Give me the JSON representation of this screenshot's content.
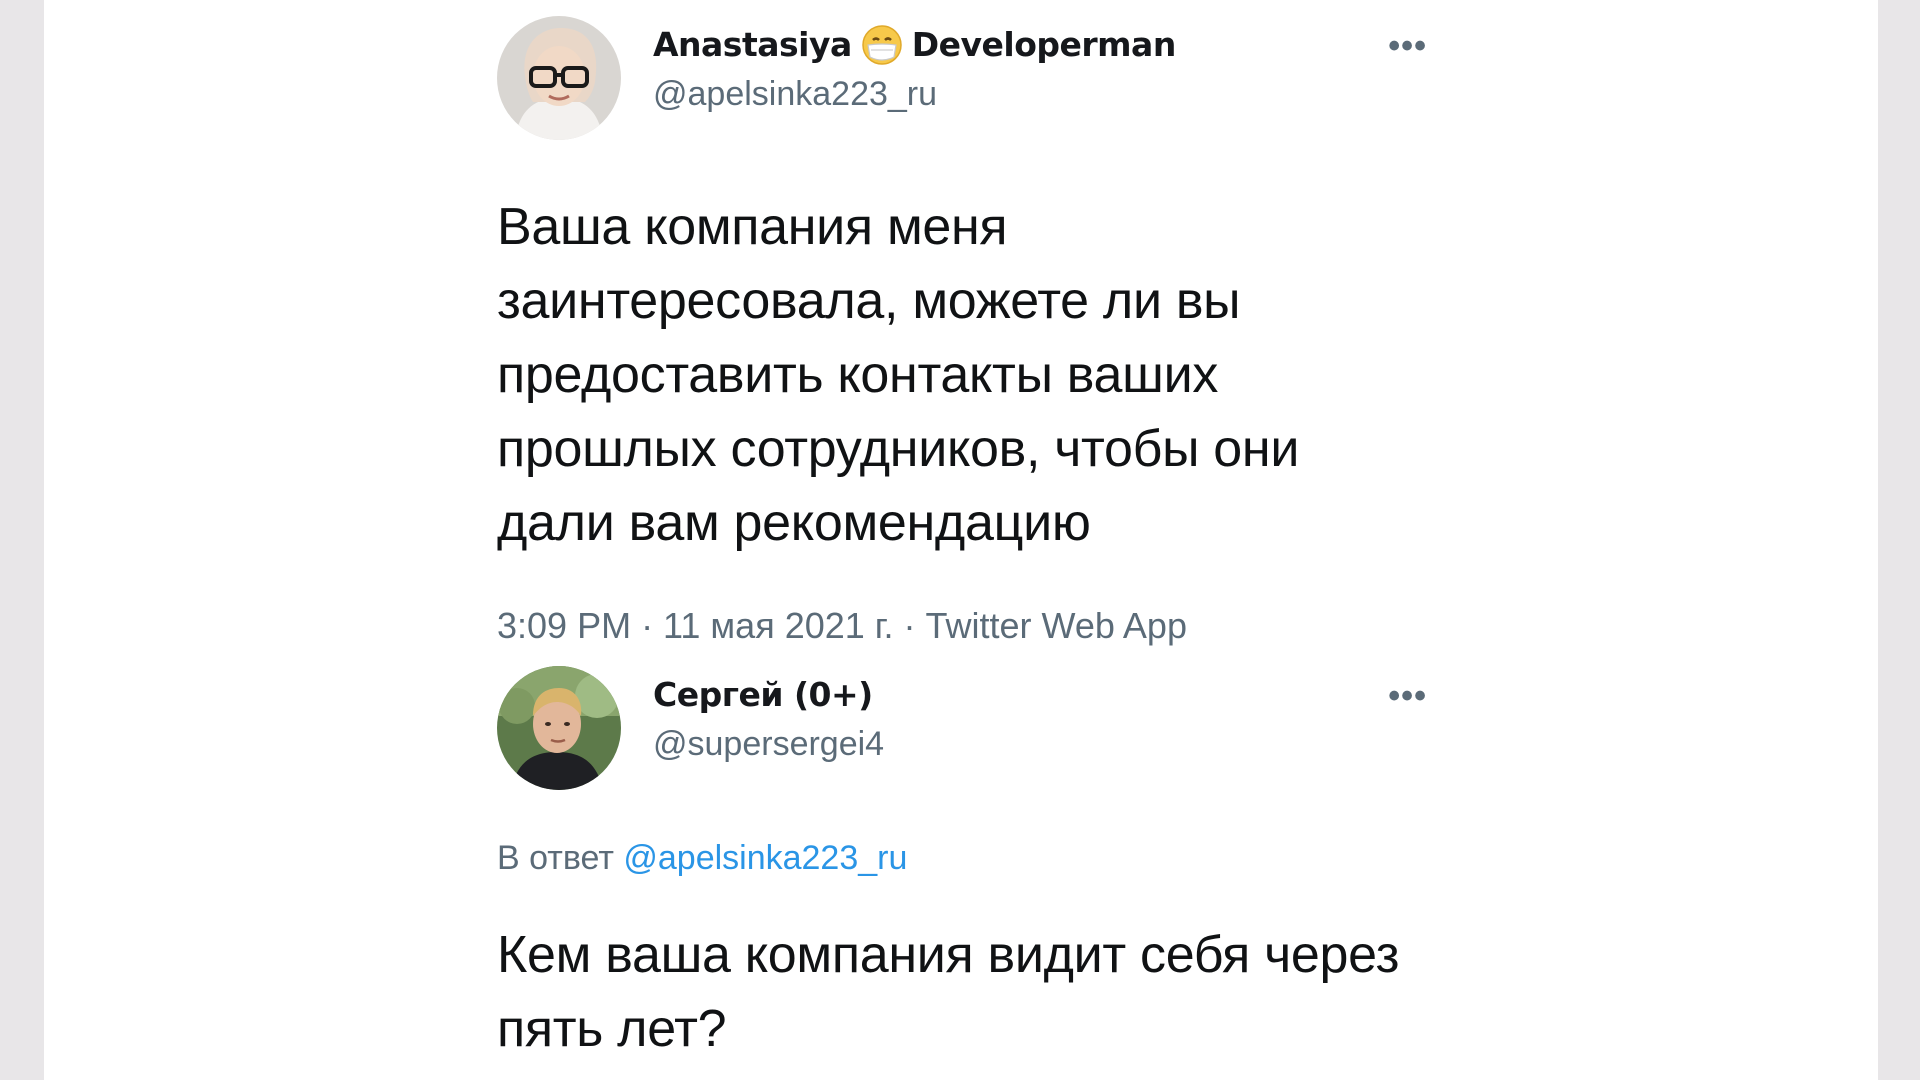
{
  "tweets": [
    {
      "display_name": "Anastasiya",
      "display_name_suffix": "Developerman",
      "emoji": "mask-face-emoji",
      "handle": "@apelsinka223_ru",
      "more_label": "•••",
      "text": "Ваша компания меня заинтересовала, можете ли вы предоставить контакты ваших прошлых сотрудников, чтобы они дали вам рекомендацию",
      "meta": "3:09 PM · 11 мая 2021 г. · Twitter Web App"
    },
    {
      "display_name": "Сергей (0+)",
      "handle": "@supersergei4",
      "more_label": "•••",
      "reply_prefix": "В ответ",
      "reply_mention": "@apelsinka223_ru",
      "text": "Кем ваша компания видит себя через пять лет?"
    }
  ],
  "colors": {
    "text": "#101214",
    "secondary": "#5b6b78",
    "link": "#2a95e6",
    "background": "#ffffff",
    "side": "#e8e6e8"
  }
}
